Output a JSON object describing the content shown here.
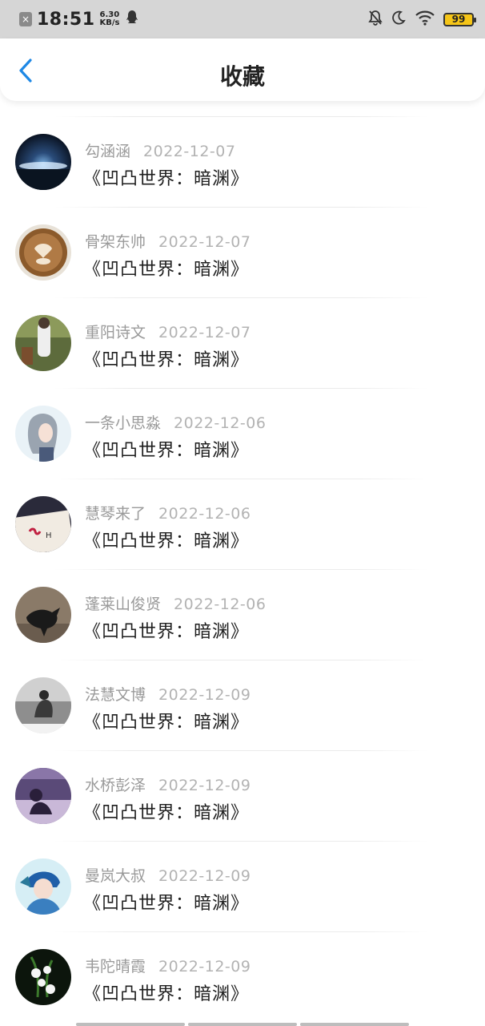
{
  "status_bar": {
    "time": "18:51",
    "speed_value": "6.30",
    "speed_unit": "KB/s",
    "battery": "99",
    "battery_color": "#f5c518"
  },
  "header": {
    "title": "收藏",
    "back_icon": "chevron-left-icon",
    "accent": "#1e88e5"
  },
  "favorites": [
    {
      "user": "勾涵涵",
      "date": "2022-12-07",
      "book": "《凹凸世界：暗渊》",
      "avatar": "night-sky"
    },
    {
      "user": "骨架东帅",
      "date": "2022-12-07",
      "book": "《凹凸世界：暗渊》",
      "avatar": "latte-art"
    },
    {
      "user": "重阳诗文",
      "date": "2022-12-07",
      "book": "《凹凸世界：暗渊》",
      "avatar": "outdoor-person"
    },
    {
      "user": "一条小思淼",
      "date": "2022-12-06",
      "book": "《凹凸世界：暗渊》",
      "avatar": "anime-girl"
    },
    {
      "user": "慧琴来了",
      "date": "2022-12-06",
      "book": "《凹凸世界：暗渊》",
      "avatar": "handwriting"
    },
    {
      "user": "蓬莱山俊贤",
      "date": "2022-12-06",
      "book": "《凹凸世界：暗渊》",
      "avatar": "crow"
    },
    {
      "user": "法慧文博",
      "date": "2022-12-09",
      "book": "《凹凸世界：暗渊》",
      "avatar": "grayscale-figure"
    },
    {
      "user": "水桥彭泽",
      "date": "2022-12-09",
      "book": "《凹凸世界：暗渊》",
      "avatar": "purple-scene"
    },
    {
      "user": "曼岚大叔",
      "date": "2022-12-09",
      "book": "《凹凸世界：暗渊》",
      "avatar": "anime-boy"
    },
    {
      "user": "韦陀晴霞",
      "date": "2022-12-09",
      "book": "《凹凸世界：暗渊》",
      "avatar": "lily-flowers"
    }
  ]
}
